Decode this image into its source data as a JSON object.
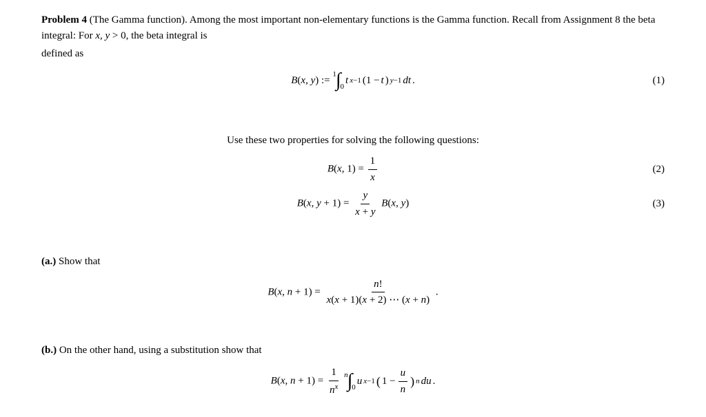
{
  "problem": {
    "number": "Problem 4",
    "title_paren": "(The Gamma function).",
    "intro": " Among the most important non-elementary functions is the Gamma function. Recall from Assignment 8 the beta integral: For ",
    "condition": "x, y > 0",
    "condition_suffix": ", the beta integral is defined as",
    "eq1_label": "(1)",
    "properties_intro": "Use these two properties for solving the following questions:",
    "eq2_label": "(2)",
    "eq3_label": "(3)",
    "part_a_label": "(a.)",
    "part_a_text": "Show that",
    "part_a_eq_label": "",
    "part_b_label": "(b.)",
    "part_b_text": "On the other hand, using a substitution show that"
  }
}
